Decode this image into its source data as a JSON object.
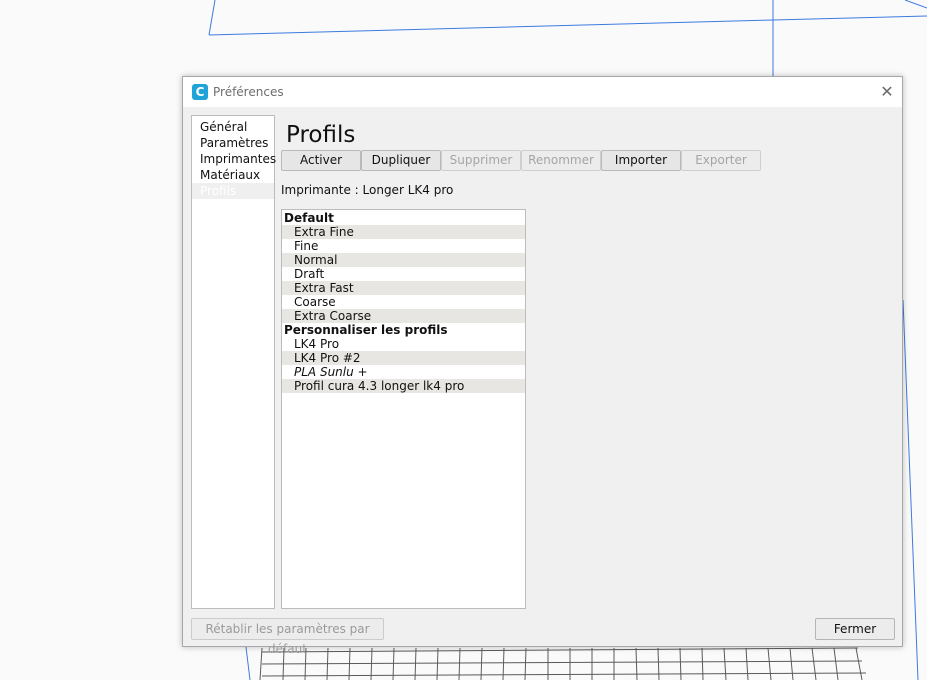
{
  "dialog": {
    "title": "Préférences",
    "app_icon_glyph": "C",
    "close_glyph": "✕",
    "accent_color": "#1fa3d8"
  },
  "sidebar": {
    "items": [
      {
        "label": "Général",
        "selected": false
      },
      {
        "label": "Paramètres",
        "selected": false
      },
      {
        "label": "Imprimantes",
        "selected": false
      },
      {
        "label": "Matériaux",
        "selected": false
      },
      {
        "label": "Profils",
        "selected": true
      }
    ]
  },
  "main": {
    "title": "Profils",
    "toolbar": {
      "activate": "Activer",
      "duplicate": "Dupliquer",
      "delete": "Supprimer",
      "rename": "Renommer",
      "import": "Importer",
      "export": "Exporter"
    },
    "printer_label": "Imprimante : Longer LK4 pro",
    "profiles": [
      {
        "label": "Default",
        "type": "header"
      },
      {
        "label": "Extra Fine",
        "type": "item"
      },
      {
        "label": "Fine",
        "type": "item"
      },
      {
        "label": "Normal",
        "type": "item"
      },
      {
        "label": "Draft",
        "type": "item"
      },
      {
        "label": "Extra Fast",
        "type": "item"
      },
      {
        "label": "Coarse",
        "type": "item"
      },
      {
        "label": "Extra Coarse",
        "type": "item"
      },
      {
        "label": "Personnaliser les profils",
        "type": "header"
      },
      {
        "label": "LK4 Pro",
        "type": "item"
      },
      {
        "label": "LK4 Pro #2",
        "type": "item"
      },
      {
        "label": "PLA Sunlu +",
        "type": "item",
        "italic": true
      },
      {
        "label": "Profil cura 4.3 longer lk4 pro",
        "type": "item"
      }
    ]
  },
  "footer": {
    "reset_label": "Rétablir les paramètres par défaut",
    "close_label": "Fermer"
  }
}
